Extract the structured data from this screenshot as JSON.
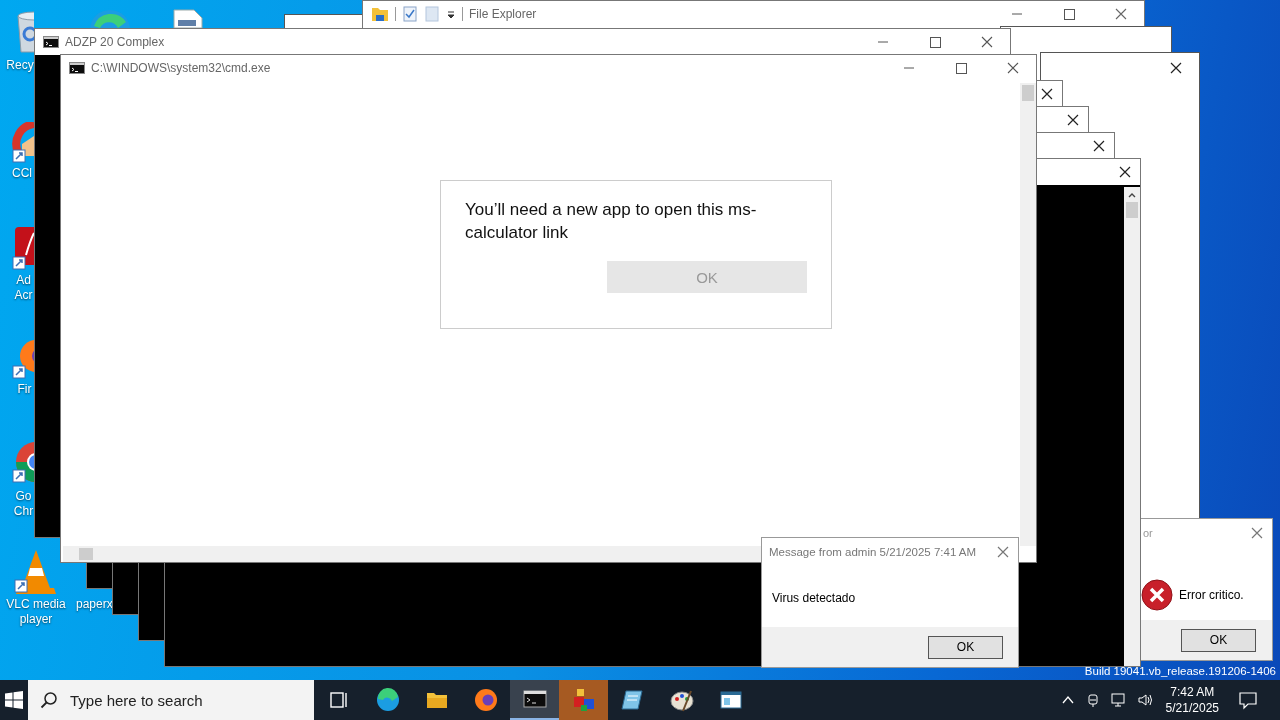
{
  "desktop_icons": [
    {
      "kind": "bin",
      "label": "Recy"
    },
    {
      "kind": "edge"
    },
    {
      "kind": "document"
    },
    {
      "kind": "ccleaner",
      "label": "CCl"
    },
    {
      "kind": "acrobat",
      "label": "Ad Acr"
    },
    {
      "kind": "firefox",
      "label": "Fir"
    },
    {
      "kind": "chrome",
      "label": "Go Chr"
    },
    {
      "kind": "vlc",
      "label": "VLC media player"
    },
    {
      "label": "paperx"
    }
  ],
  "windows": {
    "file_explorer": {
      "title": "File Explorer"
    },
    "adzp": {
      "title": "ADZP 20 Complex"
    },
    "cmd": {
      "title": "C:\\WINDOWS\\system32\\cmd.exe"
    }
  },
  "app_dialog": {
    "message": "You’ll need a new app to open this ms-calculator link",
    "button": {
      "label": "OK",
      "disabled": true
    }
  },
  "message_box": {
    "title": "Message from admin 5/21/2025 7:41 AM",
    "message": "Virus detectado",
    "button": "OK"
  },
  "error_box": {
    "title": "or",
    "message": "Error critico.",
    "button": "OK"
  },
  "build_info": "Build 19041.vb_release.191206-1406",
  "taskbar": {
    "search_placeholder": "Type here to search",
    "apps": [
      {
        "kind": "task-view",
        "open": false,
        "flashing": false
      },
      {
        "kind": "edge",
        "open": false,
        "flashing": false
      },
      {
        "kind": "folder",
        "open": false,
        "flashing": false
      },
      {
        "kind": "firefox",
        "open": false,
        "flashing": false
      },
      {
        "kind": "console",
        "open": true,
        "flashing": false
      },
      {
        "kind": "cubes",
        "open": false,
        "flashing": true
      },
      {
        "kind": "notepad",
        "open": false,
        "flashing": false
      },
      {
        "kind": "paint",
        "open": false,
        "flashing": false
      },
      {
        "kind": "window",
        "open": false,
        "flashing": false
      }
    ],
    "time": "7:42 AM",
    "date": "5/21/2025"
  }
}
